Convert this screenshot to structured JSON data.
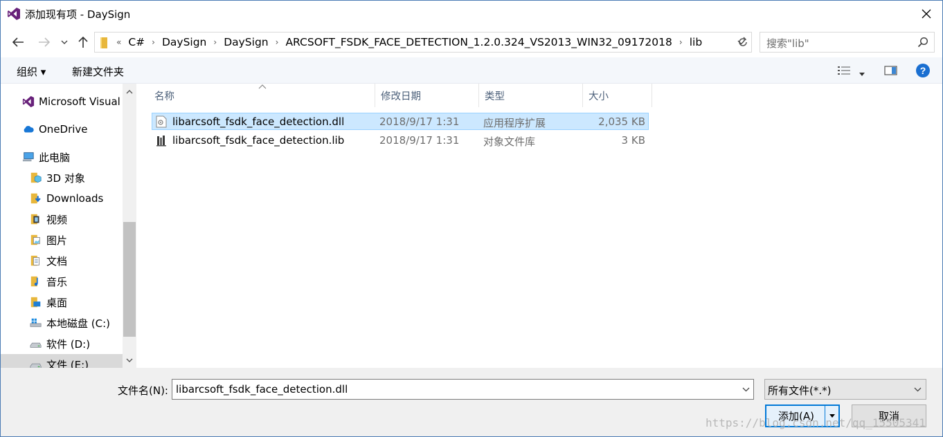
{
  "window": {
    "title": "添加现有项 - DaySign"
  },
  "address": {
    "overflow": "«",
    "crumbs": [
      "C#",
      "DaySign",
      "DaySign",
      "ARCSOFT_FSDK_FACE_DETECTION_1.2.0.324_VS2013_WIN32_09172018",
      "lib"
    ]
  },
  "search": {
    "placeholder": "搜索\"lib\""
  },
  "toolbar": {
    "organize": "组织 ▾",
    "new_folder": "新建文件夹"
  },
  "sidebar": {
    "items": [
      {
        "label": "Microsoft Visual",
        "icon": "visual-studio-icon"
      },
      {
        "label": "OneDrive",
        "icon": "cloud-icon"
      },
      {
        "label": "此电脑",
        "icon": "computer-icon"
      },
      {
        "label": "3D 对象",
        "icon": "3d-objects-icon"
      },
      {
        "label": "Downloads",
        "icon": "downloads-icon"
      },
      {
        "label": "视频",
        "icon": "video-icon"
      },
      {
        "label": "图片",
        "icon": "pictures-icon"
      },
      {
        "label": "文档",
        "icon": "documents-icon"
      },
      {
        "label": "音乐",
        "icon": "music-icon"
      },
      {
        "label": "桌面",
        "icon": "desktop-icon"
      },
      {
        "label": "本地磁盘 (C:)",
        "icon": "windows-drive-icon"
      },
      {
        "label": "软件 (D:)",
        "icon": "drive-icon"
      },
      {
        "label": "文件 (E:)",
        "icon": "drive-icon"
      }
    ]
  },
  "columns": {
    "name": "名称",
    "modified": "修改日期",
    "type": "类型",
    "size": "大小"
  },
  "files": [
    {
      "name": "libarcsoft_fsdk_face_detection.dll",
      "modified": "2018/9/17 1:31",
      "type": "应用程序扩展",
      "size": "2,035 KB",
      "icon": "dll-file-icon",
      "selected": true
    },
    {
      "name": "libarcsoft_fsdk_face_detection.lib",
      "modified": "2018/9/17 1:31",
      "type": "对象文件库",
      "size": "3 KB",
      "icon": "lib-file-icon",
      "selected": false
    }
  ],
  "bottom": {
    "filename_label": "文件名(N):",
    "filename_value": "libarcsoft_fsdk_face_detection.dll",
    "filter_value": "所有文件(*.*)",
    "add_label": "添加(A)",
    "cancel_label": "取消",
    "watermark": "https://blog.csdn.net/qq_15505341"
  },
  "colors": {
    "selection_bg": "#cce8ff",
    "selection_border": "#99d1ff",
    "accent": "#0078d7"
  }
}
